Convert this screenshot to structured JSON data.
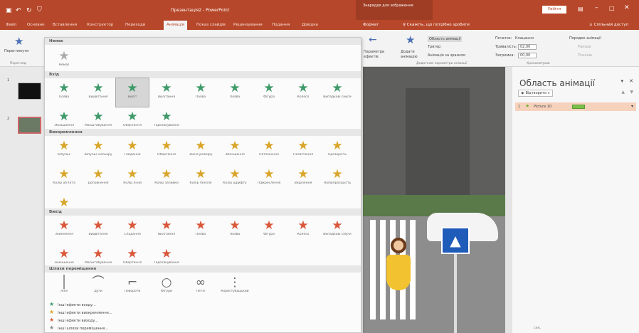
{
  "app": {
    "title": "Презентація2 - PowerPoint",
    "context_tab": "Знаряддя для зображення",
    "search_btn": "Увійти",
    "share": "Спільний доступ",
    "tell_me": "Скажіть, що потрібно зробити"
  },
  "tabs": [
    "Файл",
    "Основне",
    "Вставлення",
    "Конструктор",
    "Переходи",
    "Анімація",
    "Показ слайдів",
    "Рецензування",
    "Подання",
    "Довідка",
    "Формат"
  ],
  "active_tab": "Анімація",
  "ribbon": {
    "preview": "Переглянути",
    "preview_group": "Перегляд",
    "effect_params": "Параметри ефектів",
    "add_anim": "Додати анімацію",
    "adv_group": "Додаткові параметри анімації",
    "anim_pane_btn": "Область анімації",
    "trigger": "Тригер",
    "painter": "Анімація за зразком",
    "start_label": "Початок:",
    "start_val": "Клацання",
    "duration_label": "Тривалість:",
    "duration_val": "02,00",
    "delay_label": "Затримка:",
    "delay_val": "00,00",
    "timing_group": "Хронометраж",
    "reorder": "Порядок анімації",
    "earlier": "Раніше",
    "later": "Пізніше"
  },
  "gallery": {
    "s_none": "Немає",
    "none": [
      "Немає"
    ],
    "s_entrance": "Вхід",
    "entrance": [
      "Поява",
      "Вицвітання",
      "Виліт",
      "Вилітання",
      "Поява",
      "Поява",
      "Фігура",
      "Колесо",
      "Випадкові смуги",
      "Збільшення",
      "Масштабування",
      "Обертання",
      "Підскакування"
    ],
    "s_emphasis": "Виокремлення",
    "emphasis": [
      "Імпульс",
      "Імпульс кольору",
      "Гойдання",
      "Обертання",
      "Зміна розміру",
      "Зменшення",
      "Потемніння",
      "Посвітління",
      "Прозорість",
      "Колір об'єкта",
      "Доповнення",
      "Колір ліній",
      "Колір заливки",
      "Колір пензля",
      "Колір шрифту",
      "Підкреслення",
      "Виділення",
      "Напівпрозорість",
      "Хвиля"
    ],
    "s_exit": "Вихід",
    "exit": [
      "Зникнення",
      "Вицвітання",
      "Спадання",
      "Вилітання",
      "Поява",
      "Поява",
      "Фігура",
      "Колесо",
      "Випадкові смуги",
      "Зменшення",
      "Масштабування",
      "Обертання",
      "Підскакування"
    ],
    "s_motion": "Шляхи переміщення",
    "motion": [
      "Лінії",
      "Дуги",
      "Повороти",
      "Фігури",
      "Петлі",
      "Користувацький"
    ],
    "more": [
      "Інші ефекти входу...",
      "Інші ефекти виокремлення...",
      "Інші ефекти виходу...",
      "Інші шляхи переміщення..."
    ]
  },
  "pane": {
    "title": "Область анімації",
    "play": "Відтворити з",
    "item_num": "1",
    "item_name": "Picture 10",
    "sec": "сек."
  },
  "slides": [
    "1",
    "2"
  ]
}
